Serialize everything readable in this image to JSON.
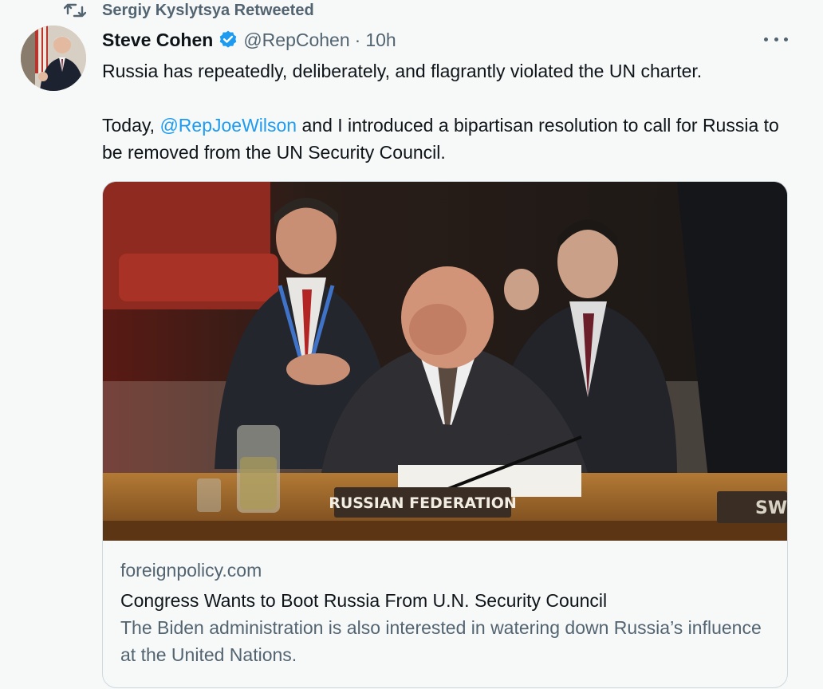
{
  "retweet": {
    "icon": "retweet-icon",
    "text": "Sergiy Kyslytsya Retweeted"
  },
  "tweet": {
    "author_name": "Steve Cohen",
    "verified": true,
    "handle": "@RepCohen",
    "separator": "·",
    "time": "10h",
    "text_line1": "Russia has repeatedly, deliberately, and flagrantly violated the UN charter.",
    "text_p2_start": "Today, ",
    "mention": "@RepJoeWilson",
    "text_p2_end": " and I introduced a bipartisan resolution to call for Russia to be removed from the UN Security Council."
  },
  "card": {
    "image_placard": "RUSSIAN FEDERATION",
    "image_placard_right": "SW",
    "domain": "foreignpolicy.com",
    "title": "Congress Wants to Boot Russia From U.N. Security Council",
    "description": "The Biden administration is also interested in watering down Russia’s influence at the United Nations."
  },
  "colors": {
    "link": "#1d9bf0",
    "secondary_text": "#536471",
    "primary_text": "#0f1419",
    "background": "#f7f9f9",
    "border": "#cfd9de"
  }
}
